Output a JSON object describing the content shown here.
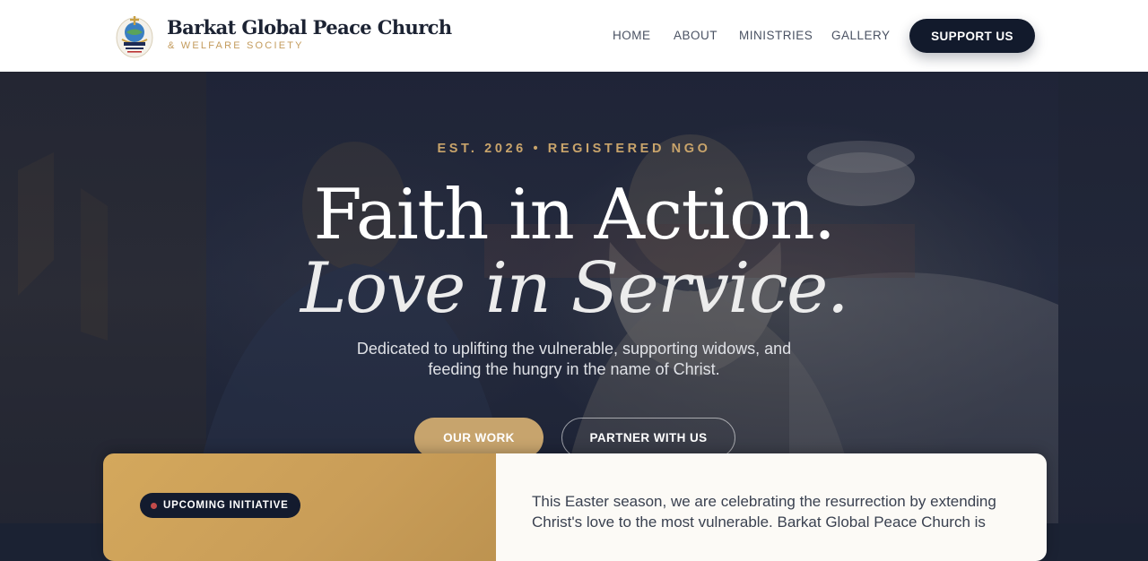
{
  "header": {
    "logo": {
      "icon": "church-crest-icon",
      "badge_text": "BARKAT GLOBAL PEACE"
    },
    "brand_name": "Barkat Global Peace Church",
    "brand_sub": "& WELFARE SOCIETY",
    "nav": [
      {
        "label": "HOME"
      },
      {
        "label": "ABOUT"
      },
      {
        "label": "MINISTRIES"
      },
      {
        "label": "GALLERY"
      }
    ],
    "support_label": "SUPPORT US"
  },
  "hero": {
    "eyebrow": "EST. 2026 • REGISTERED NGO",
    "headline_1": "Faith in Action.",
    "headline_2": "Love in Service.",
    "tagline": "Dedicated to uplifting the vulnerable, supporting widows, and feeding the hungry in the name of Christ.",
    "primary_button": "OUR WORK",
    "secondary_button": "PARTNER WITH US"
  },
  "card": {
    "badge": "UPCOMING INITIATIVE",
    "text": "This Easter season, we are celebrating the resurrection by extending Christ's love to the most vulnerable. Barkat Global Peace Church is"
  },
  "colors": {
    "navy": "#121a2c",
    "gold": "#c9a46b",
    "card_gold": "#d4a85c",
    "card_light": "#fcfaf6",
    "accent_dot": "#c24b4b"
  }
}
